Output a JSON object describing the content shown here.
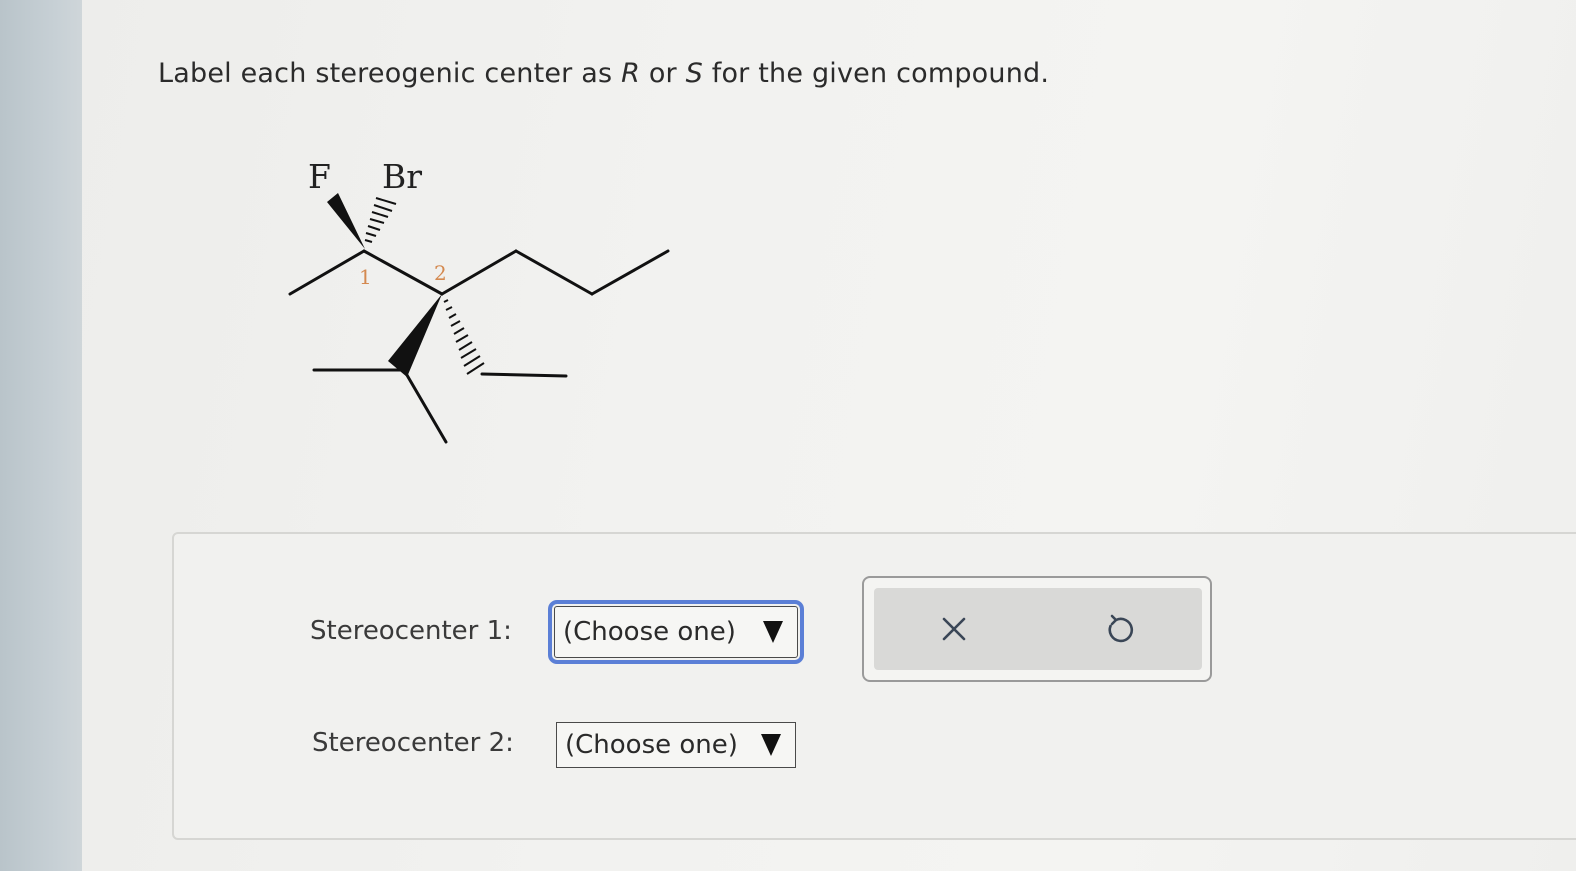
{
  "question": {
    "prefix": "Label each stereogenic center as ",
    "r": "R",
    "middle": " or ",
    "s": "S",
    "suffix": " for the given compound."
  },
  "molecule": {
    "atom_labels": [
      "F",
      "Br"
    ],
    "center_labels": [
      "1",
      "2"
    ]
  },
  "answers": {
    "rows": [
      {
        "label": "Stereocenter 1:",
        "selected": "(Choose one)"
      },
      {
        "label": "Stereocenter 2:",
        "selected": "(Choose one)"
      }
    ]
  },
  "toolbar": {
    "buttons": [
      "close-icon",
      "undo-icon"
    ]
  },
  "colors": {
    "focus_outline": "#5b7fd6",
    "center_number": "#d4894f"
  }
}
